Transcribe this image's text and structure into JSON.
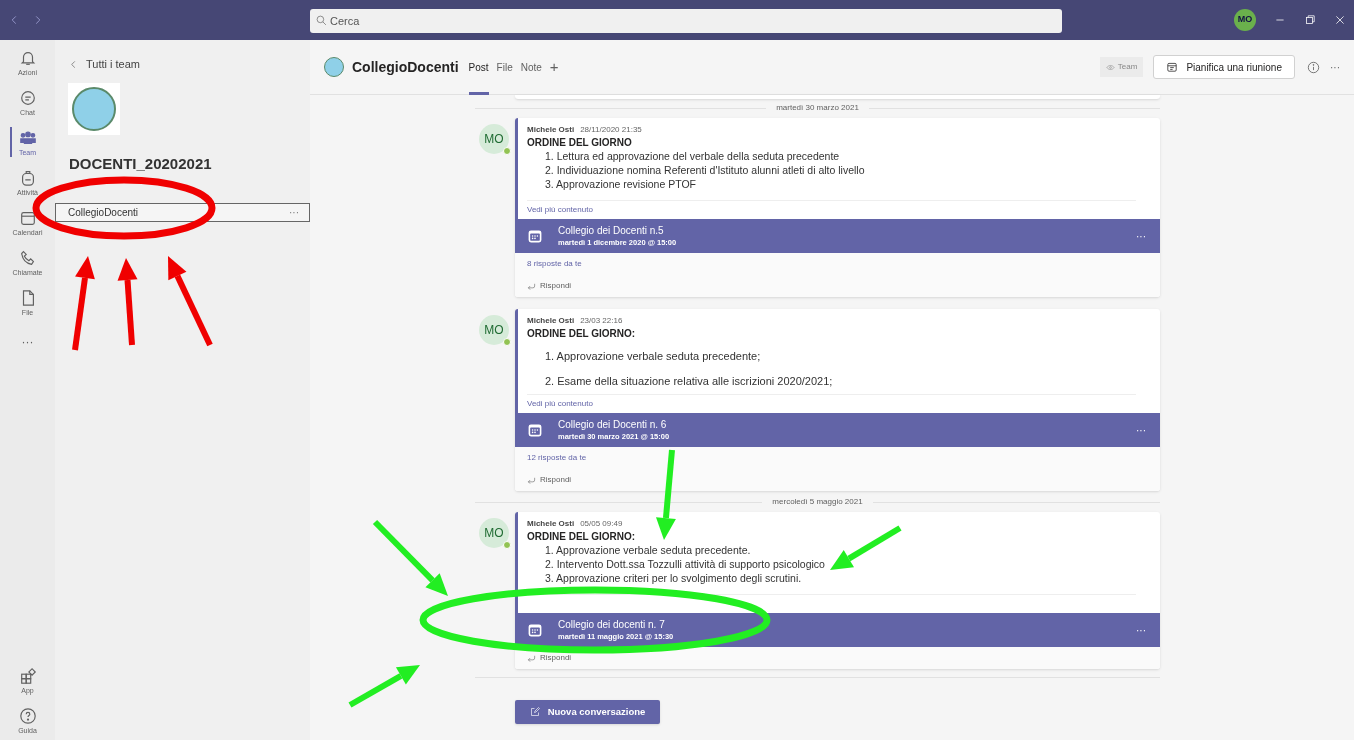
{
  "top_bar": {
    "search_placeholder": "Cerca",
    "avatar": "MO"
  },
  "rail": [
    {
      "label": "Azioni",
      "selected": false
    },
    {
      "label": "Chat",
      "selected": false
    },
    {
      "label": "Team",
      "selected": true
    },
    {
      "label": "Attività",
      "selected": false
    },
    {
      "label": "Calendari",
      "selected": false
    },
    {
      "label": "Chiamate",
      "selected": false
    },
    {
      "label": "File",
      "selected": false
    },
    {
      "label": "···",
      "selected": false
    }
  ],
  "rail_bottom": [
    {
      "label": "App",
      "selected": false
    },
    {
      "label": "Guida",
      "selected": false
    }
  ],
  "sidebar": {
    "back_link": "Tutti i team",
    "team_name": "DOCENTI_20202021",
    "channels": [
      {
        "name": "CollegioDocenti",
        "selected": true,
        "more": "···"
      }
    ]
  },
  "channel_header": {
    "name": "CollegioDocenti",
    "tabs": [
      {
        "label": "Post",
        "selected": true
      },
      {
        "label": "File",
        "selected": false
      },
      {
        "label": "Note",
        "selected": false
      }
    ],
    "add": "+",
    "team_badge": "Team",
    "meet_button": "Pianifica una riunione",
    "more": "···"
  },
  "feed": [
    {
      "kind": "divider",
      "text": "martedì 30 marzo 2021"
    },
    {
      "kind": "post",
      "avatar": "MO",
      "online": true,
      "author": "Michele Osti",
      "time": "28/11/2020 21:35",
      "heading": "ORDINE DEL GIORNO",
      "spaced": false,
      "items": [
        "1. Lettura ed approvazione del verbale della seduta precedente",
        "2. Individuazione nomina Referenti d'Istituto alunni atleti di alto livello",
        "3. Approvazione revisione PTOF"
      ],
      "see_more": "Vedi più contenuto",
      "meeting": {
        "title": "Collegio dei Docenti n.5",
        "when": "martedì 1 dicembre 2020 @ 15:00",
        "more": "···"
      },
      "replies": "8 risposte da te",
      "reply": "Rispondi"
    },
    {
      "kind": "post",
      "avatar": "MO",
      "online": true,
      "author": "Michele Osti",
      "time": "23/03 22:16",
      "heading": "ORDINE DEL GIORNO:",
      "spaced": true,
      "items": [
        "1. Approvazione verbale seduta precedente;",
        "2. Esame della situazione relativa alle iscrizioni 2020/2021;"
      ],
      "see_more": "Vedi più contenuto",
      "meeting": {
        "title": "Collegio dei Docenti n. 6",
        "when": "martedì 30 marzo 2021 @ 15:00",
        "more": "···"
      },
      "replies": "12 risposte da te",
      "reply": "Rispondi"
    },
    {
      "kind": "divider",
      "text": "mercoledì 5 maggio 2021"
    },
    {
      "kind": "post",
      "avatar": "MO",
      "online": true,
      "author": "Michele Osti",
      "time": "05/05 09:49",
      "heading": "ORDINE DEL GIORNO:",
      "spaced": false,
      "items": [
        "1. Approvazione verbale seduta precedente.",
        "2. Intervento Dott.ssa Tozzulli attività di supporto psicologico",
        "3. Approvazione criteri per lo svolgimento degli scrutini."
      ],
      "meeting": {
        "title": "Collegio dei docenti n. 7",
        "when": "martedì 11 maggio 2021 @ 15:30",
        "more": "···"
      },
      "reply": "Rispondi"
    }
  ],
  "new_conversation": "Nuova conversazione"
}
